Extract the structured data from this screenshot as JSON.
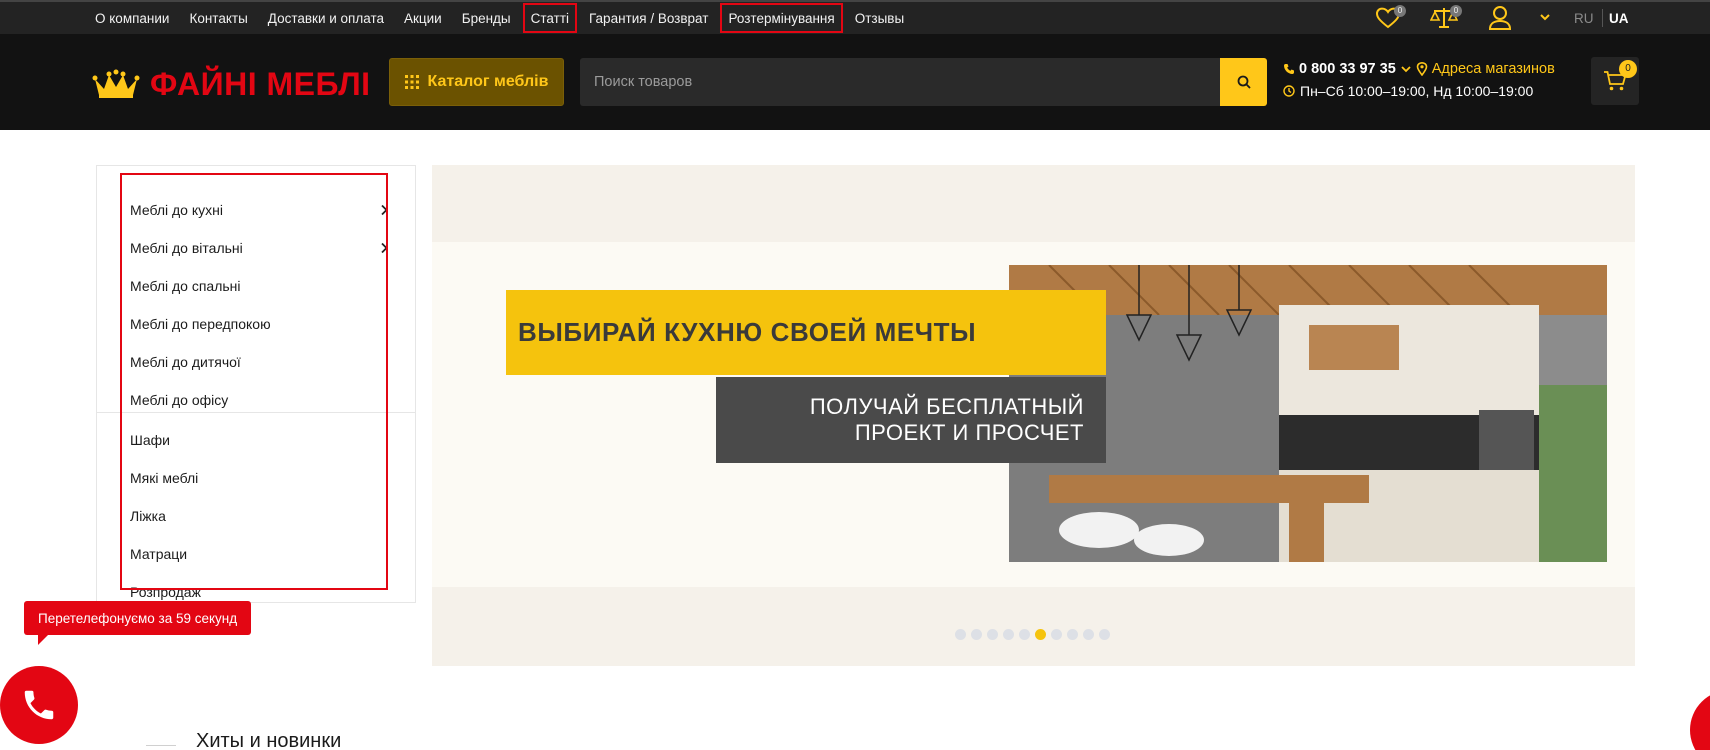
{
  "topnav": {
    "items": [
      {
        "label": "О компании"
      },
      {
        "label": "Контакты"
      },
      {
        "label": "Доставки и оплата"
      },
      {
        "label": "Акции"
      },
      {
        "label": "Бренды"
      },
      {
        "label": "Статті"
      },
      {
        "label": "Гарантия / Возврат"
      },
      {
        "label": "Розтермінування"
      },
      {
        "label": "Отзывы"
      }
    ],
    "wishlist_count": "0",
    "compare_count": "0",
    "lang_ru": "RU",
    "lang_ua": "UA"
  },
  "header": {
    "logo_text": "ФАЙНІ МЕБЛІ",
    "catalog_label": "Каталог меблів",
    "search_placeholder": "Поиск товаров",
    "phone": "0 800 33 97 35",
    "addresses_label": "Адреса магазинов",
    "hours": "Пн–Сб 10:00–19:00, Нд 10:00–19:00",
    "cart_count": "0"
  },
  "sidebar": {
    "items": [
      {
        "label": "Меблі до кухні",
        "has_submenu": true
      },
      {
        "label": "Меблі до вітальні",
        "has_submenu": true
      },
      {
        "label": "Меблі до спальні",
        "has_submenu": false
      },
      {
        "label": "Меблі до передпокою",
        "has_submenu": false
      },
      {
        "label": "Меблі до дитячої",
        "has_submenu": false
      },
      {
        "label": "Меблі до офісу",
        "has_submenu": false
      },
      {
        "label": "Шафи",
        "has_submenu": false
      },
      {
        "label": "Мякі меблі",
        "has_submenu": false
      },
      {
        "label": "Ліжка",
        "has_submenu": false
      },
      {
        "label": "Матраци",
        "has_submenu": false
      },
      {
        "label": "Розпродаж",
        "has_submenu": false
      }
    ]
  },
  "banner": {
    "headline": "ВЫБИРАЙ КУХНЮ СВОЕЙ МЕЧТЫ",
    "sub_line1": "ПОЛУЧАЙ БЕСПЛАТНЫЙ",
    "sub_line2": "ПРОЕКТ И ПРОСЧЕТ",
    "slide_count": 10,
    "active_slide": 6
  },
  "callback": {
    "tooltip": "Перетелефонуємо за 59 секунд"
  },
  "section": {
    "hits_title": "Хиты и новинки"
  },
  "colors": {
    "accent_yellow": "#ffc719",
    "brand_red": "#e30613",
    "header_bg": "#121212",
    "topbar_bg": "#232323"
  }
}
